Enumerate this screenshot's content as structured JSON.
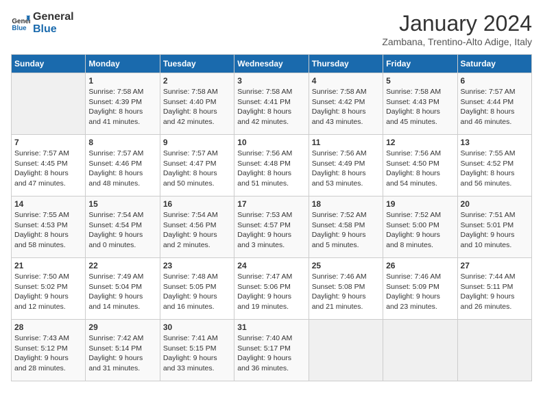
{
  "logo": {
    "line1": "General",
    "line2": "Blue"
  },
  "title": "January 2024",
  "location": "Zambana, Trentino-Alto Adige, Italy",
  "weekdays": [
    "Sunday",
    "Monday",
    "Tuesday",
    "Wednesday",
    "Thursday",
    "Friday",
    "Saturday"
  ],
  "weeks": [
    [
      {
        "day": "",
        "info": ""
      },
      {
        "day": "1",
        "info": "Sunrise: 7:58 AM\nSunset: 4:39 PM\nDaylight: 8 hours\nand 41 minutes."
      },
      {
        "day": "2",
        "info": "Sunrise: 7:58 AM\nSunset: 4:40 PM\nDaylight: 8 hours\nand 42 minutes."
      },
      {
        "day": "3",
        "info": "Sunrise: 7:58 AM\nSunset: 4:41 PM\nDaylight: 8 hours\nand 42 minutes."
      },
      {
        "day": "4",
        "info": "Sunrise: 7:58 AM\nSunset: 4:42 PM\nDaylight: 8 hours\nand 43 minutes."
      },
      {
        "day": "5",
        "info": "Sunrise: 7:58 AM\nSunset: 4:43 PM\nDaylight: 8 hours\nand 45 minutes."
      },
      {
        "day": "6",
        "info": "Sunrise: 7:57 AM\nSunset: 4:44 PM\nDaylight: 8 hours\nand 46 minutes."
      }
    ],
    [
      {
        "day": "7",
        "info": "Sunrise: 7:57 AM\nSunset: 4:45 PM\nDaylight: 8 hours\nand 47 minutes."
      },
      {
        "day": "8",
        "info": "Sunrise: 7:57 AM\nSunset: 4:46 PM\nDaylight: 8 hours\nand 48 minutes."
      },
      {
        "day": "9",
        "info": "Sunrise: 7:57 AM\nSunset: 4:47 PM\nDaylight: 8 hours\nand 50 minutes."
      },
      {
        "day": "10",
        "info": "Sunrise: 7:56 AM\nSunset: 4:48 PM\nDaylight: 8 hours\nand 51 minutes."
      },
      {
        "day": "11",
        "info": "Sunrise: 7:56 AM\nSunset: 4:49 PM\nDaylight: 8 hours\nand 53 minutes."
      },
      {
        "day": "12",
        "info": "Sunrise: 7:56 AM\nSunset: 4:50 PM\nDaylight: 8 hours\nand 54 minutes."
      },
      {
        "day": "13",
        "info": "Sunrise: 7:55 AM\nSunset: 4:52 PM\nDaylight: 8 hours\nand 56 minutes."
      }
    ],
    [
      {
        "day": "14",
        "info": "Sunrise: 7:55 AM\nSunset: 4:53 PM\nDaylight: 8 hours\nand 58 minutes."
      },
      {
        "day": "15",
        "info": "Sunrise: 7:54 AM\nSunset: 4:54 PM\nDaylight: 9 hours\nand 0 minutes."
      },
      {
        "day": "16",
        "info": "Sunrise: 7:54 AM\nSunset: 4:56 PM\nDaylight: 9 hours\nand 2 minutes."
      },
      {
        "day": "17",
        "info": "Sunrise: 7:53 AM\nSunset: 4:57 PM\nDaylight: 9 hours\nand 3 minutes."
      },
      {
        "day": "18",
        "info": "Sunrise: 7:52 AM\nSunset: 4:58 PM\nDaylight: 9 hours\nand 5 minutes."
      },
      {
        "day": "19",
        "info": "Sunrise: 7:52 AM\nSunset: 5:00 PM\nDaylight: 9 hours\nand 8 minutes."
      },
      {
        "day": "20",
        "info": "Sunrise: 7:51 AM\nSunset: 5:01 PM\nDaylight: 9 hours\nand 10 minutes."
      }
    ],
    [
      {
        "day": "21",
        "info": "Sunrise: 7:50 AM\nSunset: 5:02 PM\nDaylight: 9 hours\nand 12 minutes."
      },
      {
        "day": "22",
        "info": "Sunrise: 7:49 AM\nSunset: 5:04 PM\nDaylight: 9 hours\nand 14 minutes."
      },
      {
        "day": "23",
        "info": "Sunrise: 7:48 AM\nSunset: 5:05 PM\nDaylight: 9 hours\nand 16 minutes."
      },
      {
        "day": "24",
        "info": "Sunrise: 7:47 AM\nSunset: 5:06 PM\nDaylight: 9 hours\nand 19 minutes."
      },
      {
        "day": "25",
        "info": "Sunrise: 7:46 AM\nSunset: 5:08 PM\nDaylight: 9 hours\nand 21 minutes."
      },
      {
        "day": "26",
        "info": "Sunrise: 7:46 AM\nSunset: 5:09 PM\nDaylight: 9 hours\nand 23 minutes."
      },
      {
        "day": "27",
        "info": "Sunrise: 7:44 AM\nSunset: 5:11 PM\nDaylight: 9 hours\nand 26 minutes."
      }
    ],
    [
      {
        "day": "28",
        "info": "Sunrise: 7:43 AM\nSunset: 5:12 PM\nDaylight: 9 hours\nand 28 minutes."
      },
      {
        "day": "29",
        "info": "Sunrise: 7:42 AM\nSunset: 5:14 PM\nDaylight: 9 hours\nand 31 minutes."
      },
      {
        "day": "30",
        "info": "Sunrise: 7:41 AM\nSunset: 5:15 PM\nDaylight: 9 hours\nand 33 minutes."
      },
      {
        "day": "31",
        "info": "Sunrise: 7:40 AM\nSunset: 5:17 PM\nDaylight: 9 hours\nand 36 minutes."
      },
      {
        "day": "",
        "info": ""
      },
      {
        "day": "",
        "info": ""
      },
      {
        "day": "",
        "info": ""
      }
    ]
  ]
}
